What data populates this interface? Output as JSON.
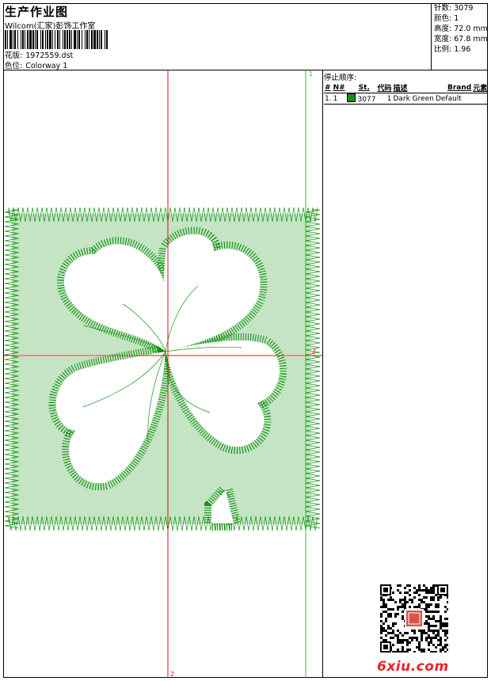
{
  "header": {
    "title": "生产作业图",
    "company": "Wilcom(汇家)彭饰工作室",
    "design_label": "花版:",
    "design_value": "1972559.dst",
    "colorway_label": "色位:",
    "colorway_value": "Colorway 1"
  },
  "stats": [
    {
      "label": "针数:",
      "value": "3079"
    },
    {
      "label": "颜色:",
      "value": "1"
    },
    {
      "label": "高度:",
      "value": "72.0 mm"
    },
    {
      "label": "宽度:",
      "value": "67.8 mm"
    },
    {
      "label": "比例:",
      "value": "1.96"
    }
  ],
  "stop_sequence": {
    "caption": "停止顺序:",
    "headers": [
      "#",
      "N#",
      "St.",
      "代码",
      "描述",
      "Brand",
      "元素"
    ],
    "rows": [
      {
        "num": "1.",
        "n": "1",
        "color": "#139213",
        "stitches": "3077",
        "code": "1",
        "description": "Dark Green",
        "brand": "Default",
        "element": ""
      }
    ]
  },
  "guides": {
    "vertical_top_label": "1",
    "horizontal_right_label": "2",
    "vertical_bottom_label": "2"
  },
  "design": {
    "thread_color": "#139213",
    "guide_red": "#e01010",
    "guide_green": "#22c422"
  },
  "watermark": {
    "text": "6xiu.com"
  }
}
